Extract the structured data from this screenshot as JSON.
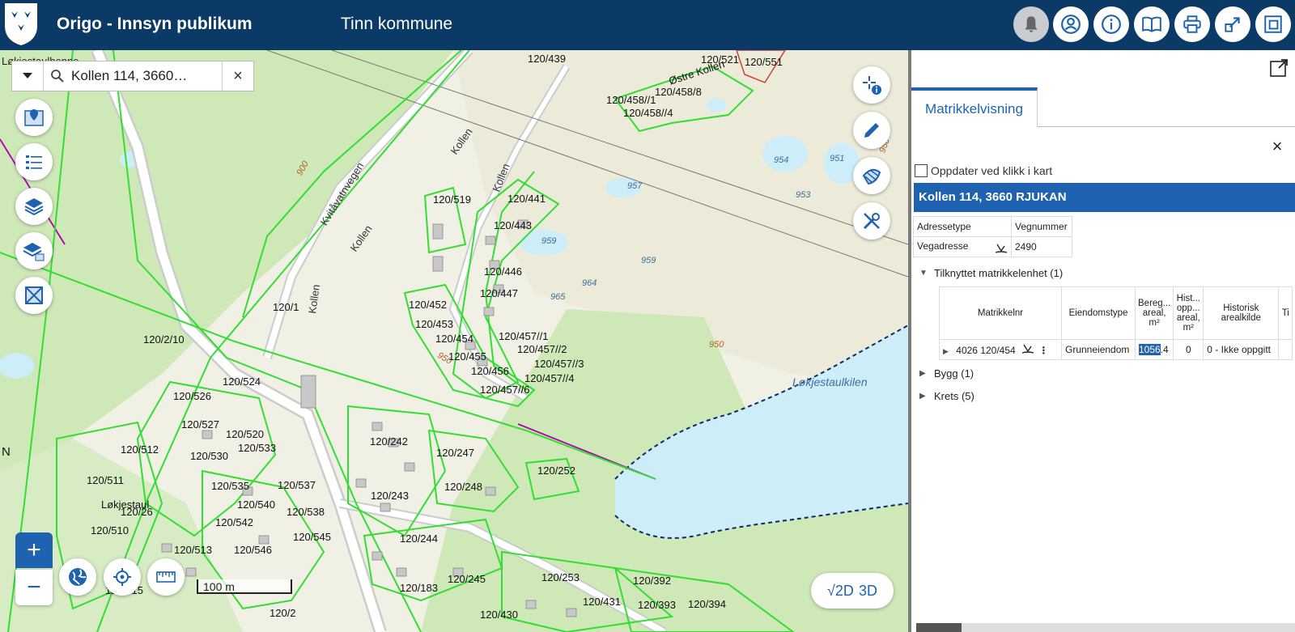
{
  "header": {
    "app_title": "Origo - Innsyn publikum",
    "municipality": "Tinn kommune",
    "colors": {
      "bar": "#0b3a66",
      "accent": "#1e62b0"
    },
    "buttons": [
      "bell-icon",
      "user-icon",
      "info-icon",
      "book-icon",
      "print-icon",
      "share-icon",
      "layers-window-icon"
    ]
  },
  "search": {
    "value": "Kollen 114, 3660…",
    "clear": "×"
  },
  "map_tools": [
    "map-pin-icon",
    "legend-list-icon",
    "layers-icon",
    "layer-visibility-icon",
    "extent-icon"
  ],
  "map_right_tools": [
    "measure-info-icon",
    "edit-icon",
    "draw-icon",
    "tools-icon"
  ],
  "map": {
    "scale": "100 m",
    "view_toggle": {
      "check": "√",
      "two_d": "2D",
      "three_d": "3D"
    },
    "labels": {
      "partial_place": "Løkjestaulhenne",
      "n_letter": "N",
      "place_lokjestaul": "Løkjestaul",
      "place_ostre_kollen": "Østre Kollen",
      "lake_name": "Løkjestaulkilen",
      "road_kvitavatn": "Kvitåvatnvegen",
      "road_kollen1": "Kollen",
      "road_kollen2": "Kollen",
      "road_kollen3": "Kollen",
      "road_kollen4": "Kollen",
      "c900": "900",
      "c950a": "950",
      "c950b": "950",
      "c950c": "950",
      "e954": "954",
      "e951": "951",
      "e957": "957",
      "e953": "953",
      "e959a": "959",
      "e959b": "959",
      "e964": "964",
      "e965": "965"
    },
    "parcels": {
      "p120_439": "120/439",
      "p120_521": "120/521",
      "p120_551": "120/551",
      "p120_458_1": "120/458//1",
      "p120_458_8": "120/458/8",
      "p120_458_4": "120/458//4",
      "p120_519": "120/519",
      "p120_441": "120/441",
      "p120_443": "120/443",
      "p120_446": "120/446",
      "p120_447": "120/447",
      "p120_452": "120/452",
      "p120_453": "120/453",
      "p120_454": "120/454",
      "p120_455": "120/455",
      "p120_456": "120/456",
      "p120_457_1": "120/457//1",
      "p120_457_2": "120/457//2",
      "p120_457_3": "120/457//3",
      "p120_457_4": "120/457//4",
      "p120_457_6": "120/457//6",
      "p120_1": "120/1",
      "p120_2_10": "120/2/10",
      "p120_524": "120/524",
      "p120_526": "120/526",
      "p120_527": "120/527",
      "p120_520": "120/520",
      "p120_533": "120/533",
      "p120_512": "120/512",
      "p120_530": "120/530",
      "p120_511": "120/511",
      "p120_535": "120/535",
      "p120_537": "120/537",
      "p120_540": "120/540",
      "p120_26": "120/26",
      "p120_538": "120/538",
      "p120_510": "120/510",
      "p120_542": "120/542",
      "p120_545": "120/545",
      "p120_513": "120/513",
      "p120_546": "120/546",
      "p120_515": "120/515",
      "p120_242": "120/242",
      "p120_247": "120/247",
      "p120_243": "120/243",
      "p120_248": "120/248",
      "p120_252": "120/252",
      "p120_244": "120/244",
      "p120_245": "120/245",
      "p120_183": "120/183",
      "p120_253": "120/253",
      "p120_392": "120/392",
      "p120_431": "120/431",
      "p120_393": "120/393",
      "p120_394": "120/394",
      "p120_2": "120/2",
      "p120_430": "120/430"
    }
  },
  "panel": {
    "tab": "Matrikkelvisning",
    "close": "×",
    "update_label": "Oppdater ved klikk i kart",
    "address_title": "Kollen 114, 3660 RJUKAN",
    "address_table": {
      "headers": [
        "Adressetype",
        "Vegnummer"
      ],
      "row": [
        "Vegadresse",
        "2490"
      ]
    },
    "linked_section": "Tilknyttet matrikkelenhet (1)",
    "matr_table": {
      "headers": [
        "Matrikkelnr",
        "Eiendomstype",
        "Bereg... areal, m²",
        "Hist... opp... areal, m²",
        "Historisk arealkilde",
        "Ti"
      ],
      "row": {
        "matrikkelnr": "4026 120/454",
        "eiendomstype": "Grunneiendom",
        "areal_selected": "1056",
        "areal_rest": ".4",
        "hist_areal": "0",
        "arealkilde": "0 - Ikke oppgitt"
      }
    },
    "bygg_section": "Bygg (1)",
    "krets_section": "Krets (5)"
  }
}
